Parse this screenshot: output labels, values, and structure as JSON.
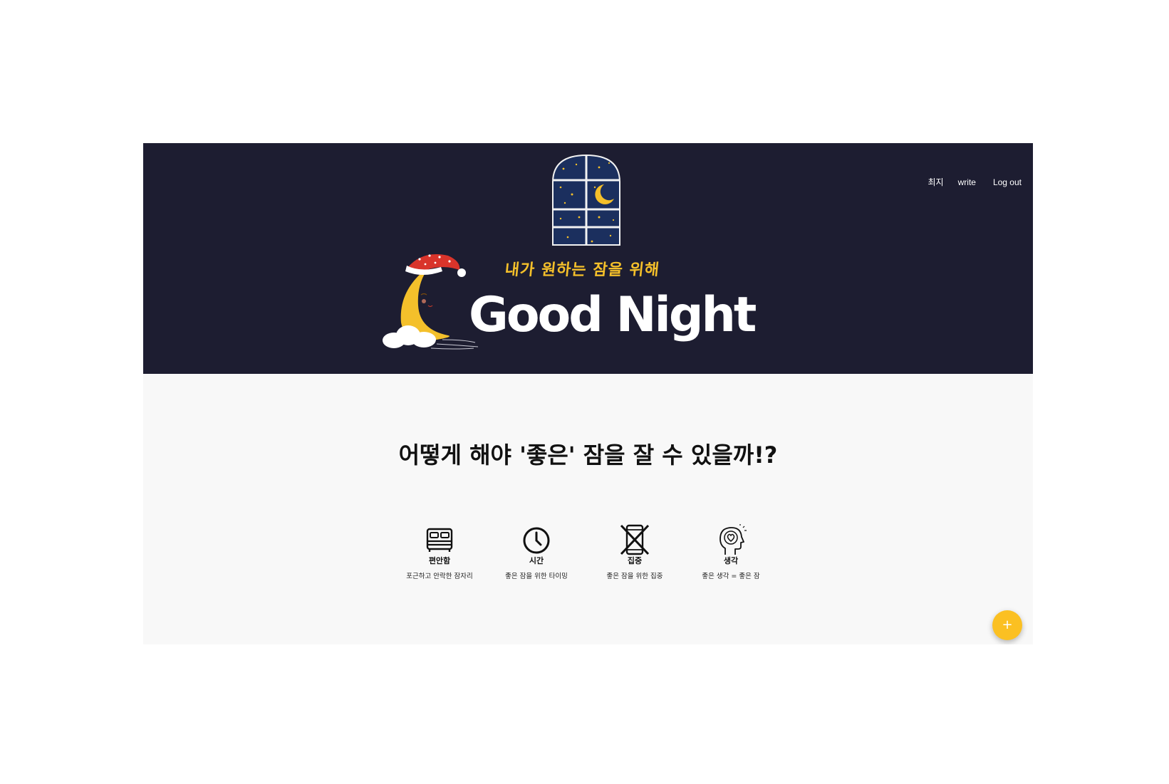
{
  "nav": {
    "items": [
      {
        "label": "최지"
      },
      {
        "label": "write"
      },
      {
        "label": "Log out"
      }
    ]
  },
  "hero": {
    "tagline": "내가 원하는 잠을 위해",
    "brand": "Good Night",
    "colors": {
      "background": "#1d1d31",
      "accent": "#f5c02a",
      "brand_text": "#ffffff"
    },
    "icons": [
      "window-night-icon",
      "sleeping-moon-icon"
    ]
  },
  "main": {
    "headline": "어떻게 해야 '좋은' 잠을 잘 수 있을까!?",
    "features": [
      {
        "icon": "bed-icon",
        "title": "편안함",
        "desc": "포근하고 안락한 잠자리"
      },
      {
        "icon": "clock-icon",
        "title": "시간",
        "desc": "좋은 잠을 위한 타이밍"
      },
      {
        "icon": "no-phone-icon",
        "title": "집중",
        "desc": "좋은 잠을 위한 집중"
      },
      {
        "icon": "mind-heart-icon",
        "title": "생각",
        "desc": "좋은 생각 = 좋은 잠"
      }
    ]
  },
  "fab": {
    "label": "+",
    "icon": "plus-icon",
    "color": "#fbc022"
  }
}
